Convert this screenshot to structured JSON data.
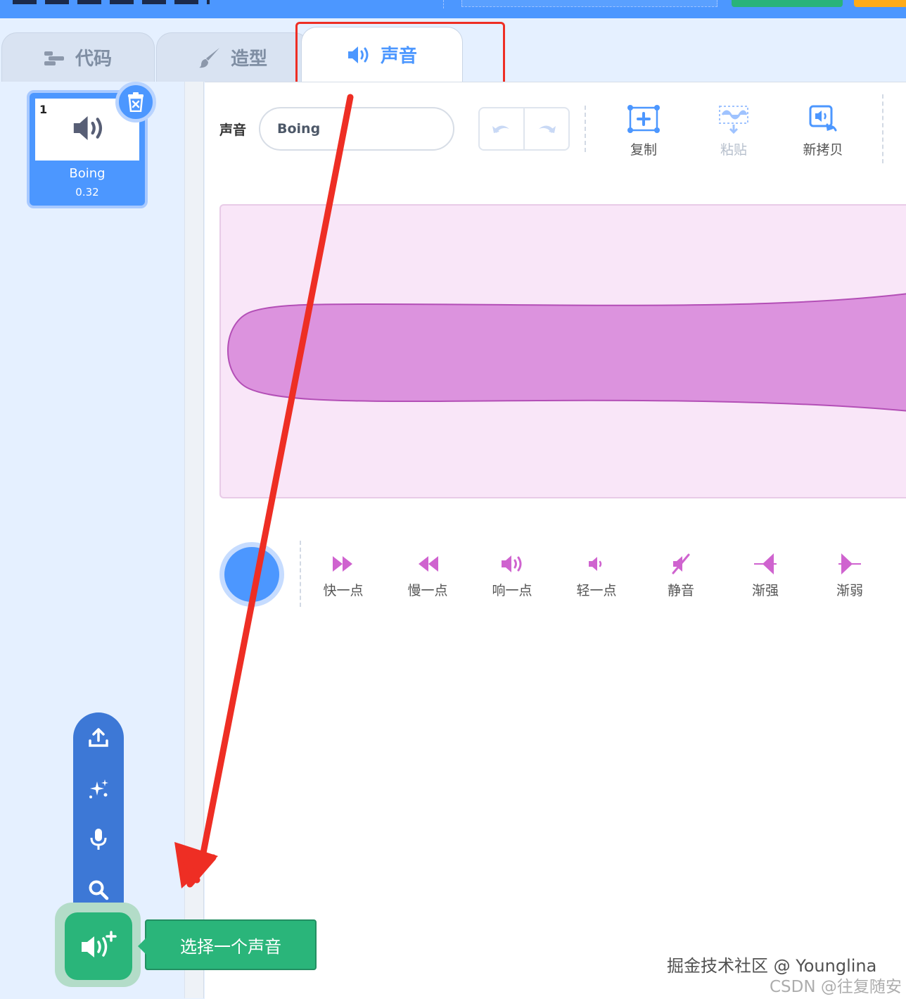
{
  "tabs": [
    {
      "label": "代码",
      "icon": "code-icon",
      "active": false
    },
    {
      "label": "造型",
      "icon": "brush-icon",
      "active": false
    },
    {
      "label": "声音",
      "icon": "speaker-icon",
      "active": true
    }
  ],
  "sound_list": [
    {
      "index": "1",
      "name": "Boing",
      "duration": "0.32",
      "selected": true
    }
  ],
  "editor": {
    "name_label": "声音",
    "name_value": "Boing",
    "tools": [
      {
        "label": "复制",
        "icon": "copy-icon",
        "enabled": true
      },
      {
        "label": "粘贴",
        "icon": "paste-icon",
        "enabled": false
      },
      {
        "label": "新拷贝",
        "icon": "new-copy-icon",
        "enabled": true
      }
    ],
    "effects": [
      {
        "label": "快一点",
        "icon": "faster-icon"
      },
      {
        "label": "慢一点",
        "icon": "slower-icon"
      },
      {
        "label": "响一点",
        "icon": "louder-icon"
      },
      {
        "label": "轻一点",
        "icon": "softer-icon"
      },
      {
        "label": "静音",
        "icon": "mute-icon"
      },
      {
        "label": "渐强",
        "icon": "fade-in-icon"
      },
      {
        "label": "渐弱",
        "icon": "fade-out-icon"
      }
    ]
  },
  "add_menu": {
    "items": [
      "upload-icon",
      "surprise-icon",
      "record-icon",
      "search-icon"
    ],
    "tooltip": "选择一个声音"
  },
  "watermarks": {
    "line1": "掘金技术社区 @ Younglina",
    "line2": "CSDN @往复随安"
  },
  "colors": {
    "accent": "#4c97ff",
    "sound_purple": "#cf63cf",
    "add_green": "#2ab57a",
    "annotation_red": "#ee2e24"
  }
}
